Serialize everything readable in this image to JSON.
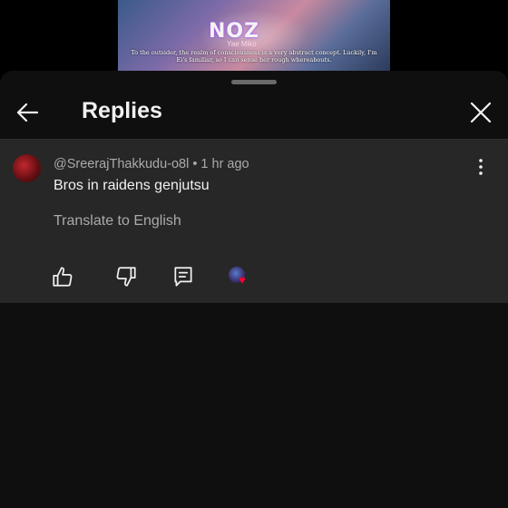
{
  "video": {
    "logo_text": "NOZ",
    "character_name": "Yae Miko",
    "subtitle": "To the outsider, the realm of consciousness is a very abstract concept. Luckily, I'm Ei's familiar, so I can sense her rough whereabouts."
  },
  "panel": {
    "title": "Replies",
    "back_icon": "arrow-left-icon",
    "close_icon": "close-icon"
  },
  "comment": {
    "author": "@SreerajThakkudu-o8l",
    "separator": "•",
    "time": "1 hr ago",
    "text": "Bros in raidens genjutsu",
    "translate_label": "Translate to English",
    "actions": {
      "like_icon": "thumbs-up-icon",
      "dislike_icon": "thumbs-down-icon",
      "reply_icon": "reply-icon",
      "creator_heart_icon": "creator-heart-icon"
    },
    "heart_color": "#ff0033"
  },
  "colors": {
    "panel_bg": "#0f0f0f",
    "comment_bg": "#272727",
    "primary_text": "#f1f1f1",
    "secondary_text": "#aaaaaa"
  }
}
